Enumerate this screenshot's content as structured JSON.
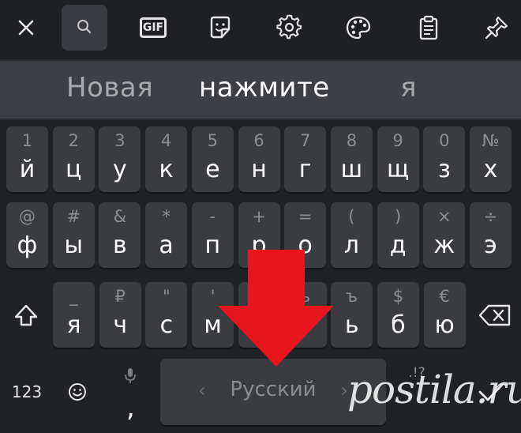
{
  "toolbar": {
    "icons": [
      "close-icon",
      "search-icon",
      "gif-icon",
      "sticker-icon",
      "gear-icon",
      "palette-icon",
      "clipboard-icon",
      "pin-icon"
    ],
    "gif_label": "GIF"
  },
  "suggestions": [
    "Новая",
    "нажмите",
    "я"
  ],
  "rows": [
    [
      {
        "sub": "1",
        "main": "й"
      },
      {
        "sub": "2",
        "main": "ц"
      },
      {
        "sub": "3",
        "main": "у"
      },
      {
        "sub": "4",
        "main": "к"
      },
      {
        "sub": "5",
        "main": "е"
      },
      {
        "sub": "6",
        "main": "н"
      },
      {
        "sub": "7",
        "main": "г"
      },
      {
        "sub": "8",
        "main": "ш"
      },
      {
        "sub": "9",
        "main": "щ"
      },
      {
        "sub": "0",
        "main": "з"
      },
      {
        "sub": "№",
        "main": "х"
      }
    ],
    [
      {
        "sub": "@",
        "main": "ф"
      },
      {
        "sub": "#",
        "main": "ы"
      },
      {
        "sub": "&",
        "main": "в"
      },
      {
        "sub": "*",
        "main": "а"
      },
      {
        "sub": "-",
        "main": "п"
      },
      {
        "sub": "+",
        "main": "р"
      },
      {
        "sub": "=",
        "main": "о"
      },
      {
        "sub": "(",
        "main": "л"
      },
      {
        "sub": ")",
        "main": "д"
      },
      {
        "sub": "×",
        "main": "ж"
      },
      {
        "sub": "÷",
        "main": "э"
      }
    ],
    [
      {
        "sub": "_",
        "main": "я"
      },
      {
        "sub": "₽",
        "main": "ч"
      },
      {
        "sub": "\"",
        "main": "с"
      },
      {
        "sub": "'",
        "main": "м"
      },
      {
        "sub": "",
        "main": ""
      },
      {
        "sub": "ь",
        "main": "т"
      },
      {
        "sub": "ъ",
        "main": "ь"
      },
      {
        "sub": "$",
        "main": "б"
      },
      {
        "sub": "€",
        "main": "ю"
      }
    ]
  ],
  "bottom": {
    "numbers_label": "123",
    "comma_sub": "",
    "comma_label": ",",
    "space_label": "Русский",
    "space_left": "‹",
    "space_right": "›",
    "enter_sub": ".!?"
  },
  "overlay": {
    "arrow_color": "#e8141e",
    "watermark": "postila.ru"
  }
}
